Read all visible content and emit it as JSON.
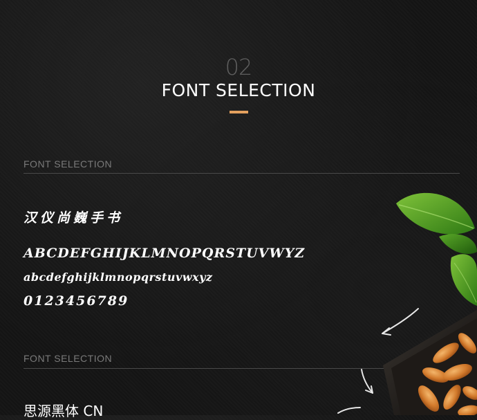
{
  "header": {
    "number": "02",
    "title": "FONT SELECTION",
    "accent_color": "#e3a05e"
  },
  "sections": [
    {
      "label": "FONT SELECTION",
      "font_name": "汉仪尚巍手书",
      "uppercase": "ABCDEFGHIJKLMNOPQRSTUVWYZ",
      "lowercase": "abcdefghijklmnopqrstuvwxyz",
      "digits": "0123456789"
    },
    {
      "label": "FONT SELECTION",
      "font_name": "思源黑体 CN"
    }
  ],
  "decor": {
    "basil_icon": "basil-leaves-icon",
    "bowl_icon": "cashew-bowl-icon",
    "arrow_icon": "chalk-arrow-icon"
  }
}
